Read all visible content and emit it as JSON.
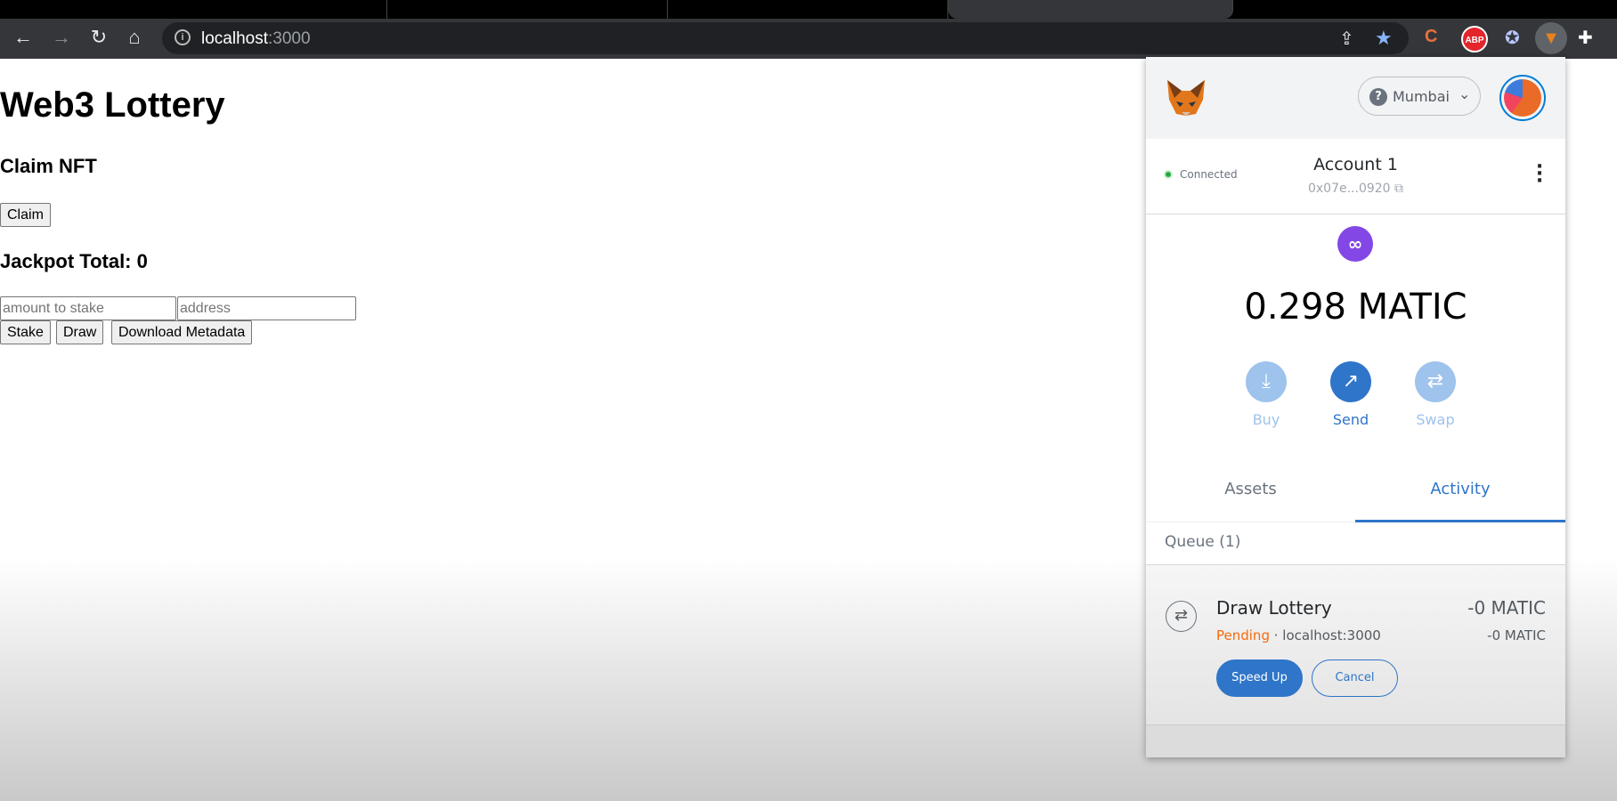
{
  "browser": {
    "url_host": "localhost",
    "url_port": ":3000",
    "icons": [
      "back-icon",
      "forward-icon",
      "reload-icon",
      "home-icon",
      "info-icon",
      "share-icon",
      "bookmark-star-icon",
      "extension-c-icon",
      "adblock-plus-icon",
      "extension-icon",
      "metamask-fox-icon",
      "puzzle-extensions-icon"
    ]
  },
  "page": {
    "title": "Web3 Lottery",
    "claim_heading": "Claim NFT",
    "claim_button": "Claim",
    "jackpot_label": "Jackpot Total: 0",
    "amount_placeholder": "amount to stake",
    "address_placeholder": "address",
    "stake_button": "Stake",
    "draw_button": "Draw",
    "download_button": "Download Metadata"
  },
  "metamask": {
    "network": "Mumbai",
    "status": "Connected",
    "account_name": "Account 1",
    "account_address": "0x07e...0920",
    "balance": "0.298 MATIC",
    "actions": [
      {
        "label": "Buy",
        "icon": "download-icon"
      },
      {
        "label": "Send",
        "icon": "arrow-up-right-icon"
      },
      {
        "label": "Swap",
        "icon": "swap-icon"
      }
    ],
    "tabs": [
      {
        "label": "Assets",
        "active": false
      },
      {
        "label": "Activity",
        "active": true
      }
    ],
    "queue_label": "Queue (1)",
    "tx": {
      "title": "Draw Lottery",
      "status": "Pending",
      "origin": "localhost:3000",
      "amount": "-0 MATIC",
      "amount_secondary": "-0 MATIC",
      "speed_up": "Speed Up",
      "cancel": "Cancel"
    },
    "colors": {
      "primary": "#2f75c9",
      "pending": "#f66a0a",
      "matic": "#8247e5",
      "connected": "#28a745"
    }
  }
}
